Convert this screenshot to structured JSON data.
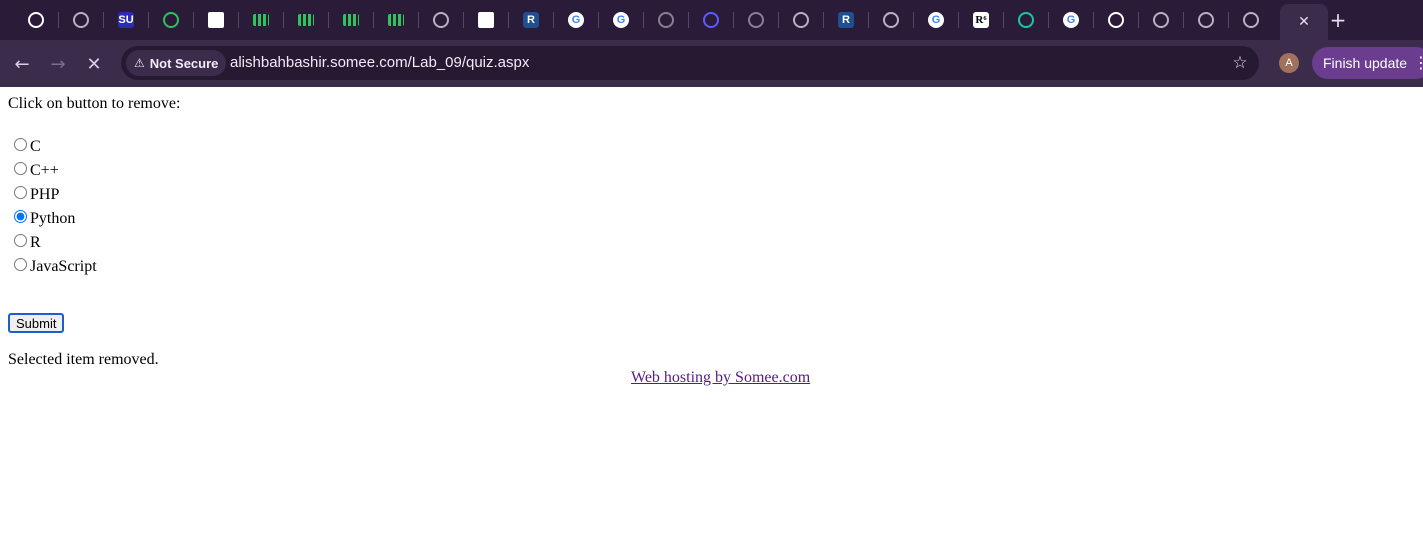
{
  "browser": {
    "tabs": [
      {
        "icon": "github-icon",
        "label": "",
        "color": "#ffffff"
      },
      {
        "icon": "globe-icon",
        "label": "",
        "color": "#b9b0c4"
      },
      {
        "icon": "su-logo-icon",
        "label": "SU",
        "color": "#2b2bb8"
      },
      {
        "icon": "green-circle-icon",
        "label": "",
        "color": "#2fc35e"
      },
      {
        "icon": "red-v-logo-icon",
        "label": "",
        "color": "#d43131"
      },
      {
        "icon": "green-bars-icon",
        "label": "",
        "color": "#2fc35e"
      },
      {
        "icon": "green-bars-icon",
        "label": "",
        "color": "#2fc35e"
      },
      {
        "icon": "green-bars-icon",
        "label": "",
        "color": "#2fc35e"
      },
      {
        "icon": "green-bars-icon",
        "label": "",
        "color": "#2fc35e"
      },
      {
        "icon": "network-icon",
        "label": "",
        "color": "#b9b0c4"
      },
      {
        "icon": "red-v-logo-icon",
        "label": "",
        "color": "#d43131"
      },
      {
        "icon": "r-logo-icon",
        "label": "R",
        "color": "#1d4f91"
      },
      {
        "icon": "google-icon",
        "label": "G",
        "color": "#ffffff"
      },
      {
        "icon": "google-icon",
        "label": "G",
        "color": "#ffffff"
      },
      {
        "icon": "lamp-icon",
        "label": "",
        "color": "#8a7f96"
      },
      {
        "icon": "blue-swirl-icon",
        "label": "",
        "color": "#5b5bff"
      },
      {
        "icon": "lamp-icon",
        "label": "",
        "color": "#8a7f96"
      },
      {
        "icon": "globe-icon",
        "label": "",
        "color": "#b9b0c4"
      },
      {
        "icon": "r-logo-icon",
        "label": "R",
        "color": "#1d4f91"
      },
      {
        "icon": "globe-icon",
        "label": "",
        "color": "#b9b0c4"
      },
      {
        "icon": "google-icon",
        "label": "G",
        "color": "#ffffff"
      },
      {
        "icon": "r6-logo-icon",
        "label": "R⁶",
        "color": "#ffffff"
      },
      {
        "icon": "teal-robot-icon",
        "label": "",
        "color": "#1bc6a8"
      },
      {
        "icon": "google-icon",
        "label": "G",
        "color": "#ffffff"
      },
      {
        "icon": "openai-icon",
        "label": "",
        "color": "#ffffff"
      },
      {
        "icon": "globe-icon",
        "label": "",
        "color": "#b9b0c4"
      },
      {
        "icon": "globe-icon",
        "label": "",
        "color": "#b9b0c4"
      },
      {
        "icon": "globe-icon",
        "label": "",
        "color": "#b9b0c4"
      }
    ],
    "active_tab_close": "✕",
    "new_tab": "+",
    "nav": {
      "back": "←",
      "forward": "→",
      "stop": "✕"
    },
    "security_chip": "Not Secure",
    "url": "alishbahbashir.somee.com/Lab_09/quiz.aspx",
    "avatar_letter": "A",
    "update_button": "Finish update",
    "menu": "⋮"
  },
  "page": {
    "prompt": "Click on button to remove:",
    "options": [
      {
        "label": "C",
        "checked": false
      },
      {
        "label": "C++",
        "checked": false
      },
      {
        "label": "PHP",
        "checked": false
      },
      {
        "label": "Python",
        "checked": true
      },
      {
        "label": "R",
        "checked": false
      },
      {
        "label": "JavaScript",
        "checked": false
      }
    ],
    "submit_label": "Submit",
    "message": "Selected item removed.",
    "hosting_link": "Web hosting by Somee.com"
  }
}
